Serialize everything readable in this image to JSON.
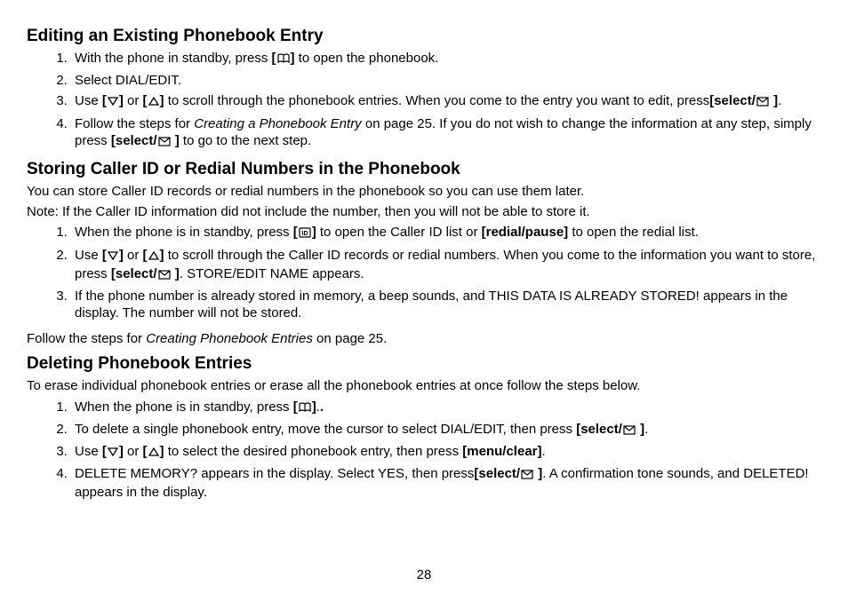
{
  "page_number": "28",
  "sections": [
    {
      "heading": "Editing an Existing Phonebook Entry",
      "items": [
        {
          "pre": "With the phone in standby, press ",
          "icon1": "book-icon",
          "post": " to open the phonebook."
        },
        {
          "text": "Select DIAL/EDIT."
        },
        {
          "pre": "Use ",
          "icon1": "down-icon",
          "mid1": " or ",
          "icon2": "up-icon",
          "mid2": " to scroll through the phonebook entries. When you come to the entry you want to edit, press",
          "sel": "[select/",
          "icon3": "envelope-icon",
          "selend": " ]",
          "post": "."
        },
        {
          "pre": "Follow the steps for ",
          "em": "Creating a Phonebook Entry",
          "mid": " on page 25. If you do not wish to change the information at any step, simply press ",
          "sel": "[select/",
          "icon1": "envelope-icon",
          "selend": " ]",
          "post": " to go to the next step."
        }
      ]
    },
    {
      "heading": "Storing Caller ID or Redial Numbers in the Phonebook",
      "intro1": "You can store Caller ID records or redial numbers in the phonebook so you can use them later.",
      "intro2": "Note: If the Caller ID information did not include the number, then you will not be able to store it.",
      "items": [
        {
          "pre": "When the phone is in standby, press ",
          "icon1": "id-icon",
          "mid": " to open the Caller ID list or ",
          "b": "[redial/pause]",
          "post": " to open the redial list."
        },
        {
          "pre": "Use ",
          "icon1": "down-icon",
          "mid1": " or ",
          "icon2": "up-icon",
          "mid2": " to scroll through the Caller ID records or redial numbers. When you come to the information you want to store, press ",
          "sel": "[select/",
          "icon3": "envelope-icon",
          "selend": " ]",
          "post": ". STORE/EDIT NAME appears."
        },
        {
          "text": "If the phone number is already stored in memory, a beep sounds, and THIS DATA IS ALREADY STORED! appears in the display. The number will not be stored."
        }
      ],
      "outro_pre": "Follow the steps for ",
      "outro_em": "Creating Phonebook Entries",
      "outro_post": " on page 25."
    },
    {
      "heading": "Deleting Phonebook Entries",
      "intro1": "To erase individual phonebook entries or erase all the phonebook entries at once follow the steps below.",
      "items": [
        {
          "pre": "When the phone is in standby, press ",
          "icon1": "book-icon",
          "post": "."
        },
        {
          "pre": "To delete a single phonebook entry, move the cursor to select DIAL/EDIT, then press ",
          "sel": "[select/",
          "icon1": "envelope-icon",
          "selend": " ]",
          "post": "."
        },
        {
          "pre": "Use ",
          "icon1": "down-icon",
          "mid1": " or ",
          "icon2": "up-icon",
          "mid2": " to select the desired phonebook entry, then press ",
          "b": "[menu/clear]",
          "post": "."
        },
        {
          "pre": "DELETE MEMORY? appears in the display. Select YES, then press",
          "sel": "[select/",
          "icon1": "envelope-icon",
          "selend": " ]",
          "post": ". A confirmation tone sounds, and DELETED! appears in the display."
        }
      ]
    }
  ]
}
